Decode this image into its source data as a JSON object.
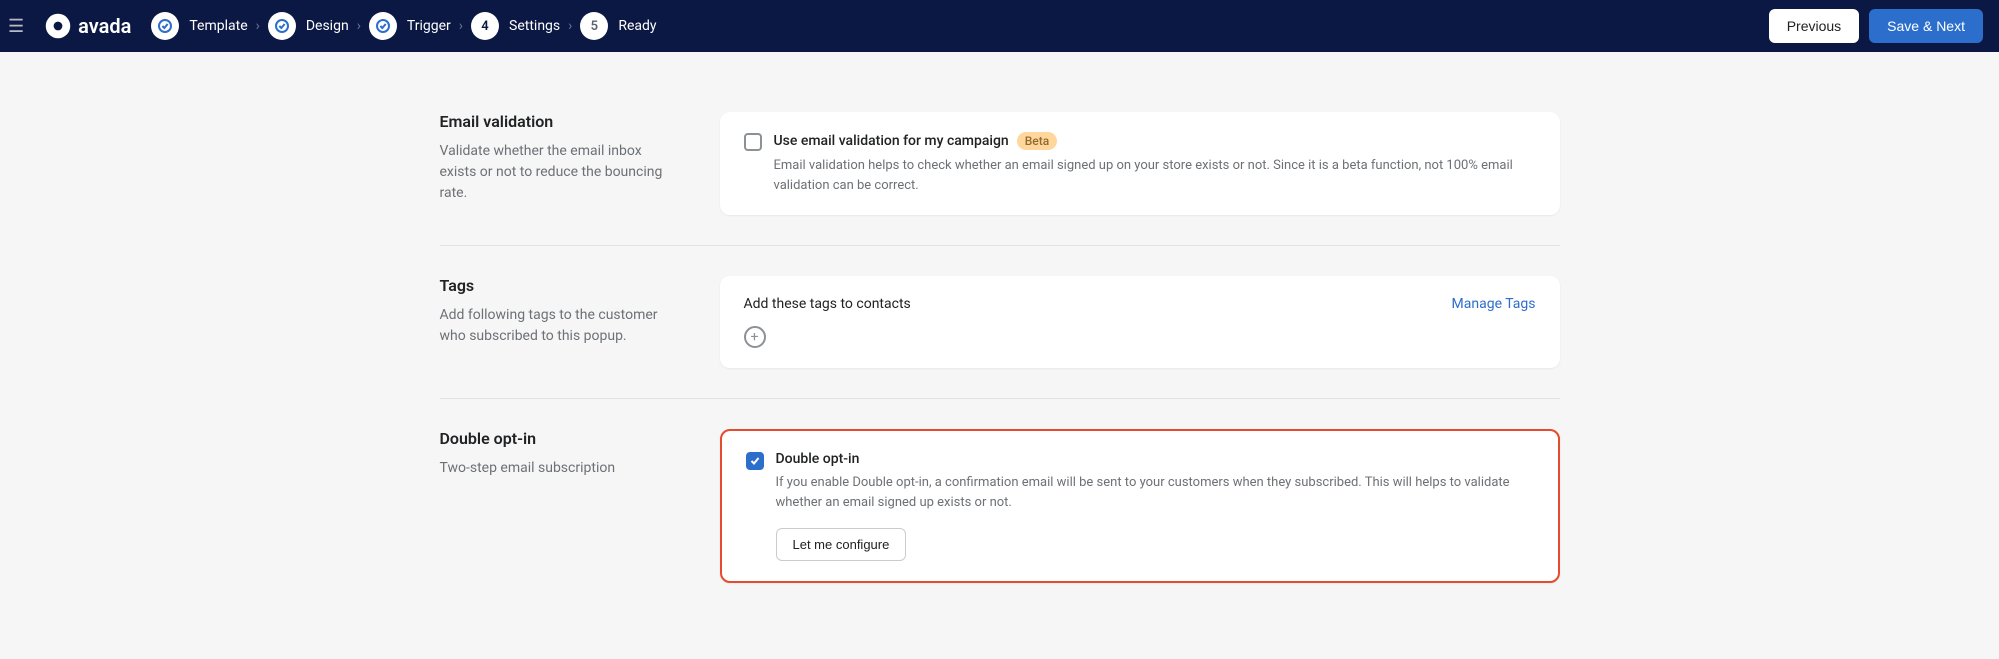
{
  "logo": "avada",
  "steps": [
    {
      "label": "Template",
      "state": "done"
    },
    {
      "label": "Design",
      "state": "done"
    },
    {
      "label": "Trigger",
      "state": "done"
    },
    {
      "label": "Settings",
      "state": "current",
      "num": "4"
    },
    {
      "label": "Ready",
      "state": "pending",
      "num": "5"
    }
  ],
  "buttons": {
    "previous": "Previous",
    "saveNext": "Save & Next"
  },
  "sections": {
    "emailValidation": {
      "title": "Email validation",
      "desc": "Validate whether the email inbox exists or not to reduce the bouncing rate.",
      "checkboxLabel": "Use email validation for my campaign",
      "badge": "Beta",
      "checkboxDesc": "Email validation helps to check whether an email signed up on your store exists or not. Since it is a beta function, not 100% email validation can be correct."
    },
    "tags": {
      "title": "Tags",
      "desc": "Add following tags to the customer who subscribed to this popup.",
      "cardTitle": "Add these tags to contacts",
      "manageLink": "Manage Tags"
    },
    "doubleOptIn": {
      "title": "Double opt-in",
      "desc": "Two-step email subscription",
      "checkboxLabel": "Double opt-in",
      "checkboxDesc": "If you enable Double opt-in, a confirmation email will be sent to your customers when they subscribed. This will helps to validate whether an email signed up exists or not.",
      "configureBtn": "Let me configure"
    }
  }
}
